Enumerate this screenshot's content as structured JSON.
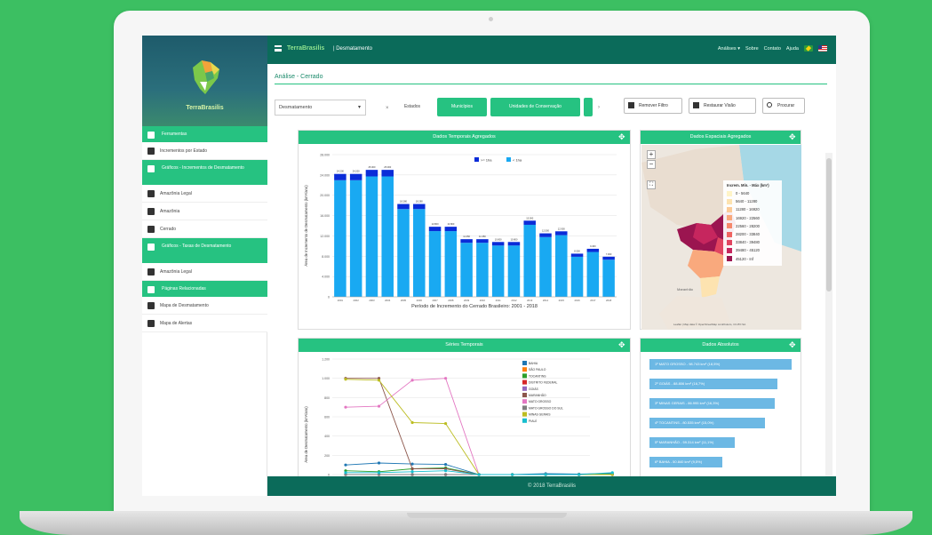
{
  "app": {
    "brand": "TerraBrasilis",
    "breadcrumb": "| Desmatamento",
    "logo_text": "TerraBrasilis",
    "footer": "© 2018 TerraBrasilis"
  },
  "nav": {
    "items": [
      "Análises ▾",
      "Sobre",
      "Contato",
      "Ajuda"
    ]
  },
  "sidebar": {
    "items": [
      {
        "type": "head",
        "label": "Ferramentas",
        "icon": "wrench-icon"
      },
      {
        "type": "item",
        "label": "Incrementos por Estado",
        "icon": "cloud-icon"
      },
      {
        "type": "head",
        "label": "Gráficos - Incrementos de Desmatamento",
        "icon": "chart-icon"
      },
      {
        "type": "item",
        "label": "Amazônia Legal",
        "icon": "chart-icon"
      },
      {
        "type": "item",
        "label": "Amazônia",
        "icon": "chart-icon"
      },
      {
        "type": "item",
        "label": "Cerrado",
        "icon": "chart-icon"
      },
      {
        "type": "head",
        "label": "Gráficos - Taxas de Desmatamento",
        "icon": "chart-icon"
      },
      {
        "type": "item",
        "label": "Amazônia Legal",
        "icon": "chart-icon"
      },
      {
        "type": "head",
        "label": "Páginas Relacionadas",
        "icon": "link-icon"
      },
      {
        "type": "item",
        "label": "Mapa de Desmatamento",
        "icon": "map-icon"
      },
      {
        "type": "item",
        "label": "Mapa de Alertas",
        "icon": "map-icon"
      }
    ]
  },
  "page": {
    "title": "Análise - Cerrado"
  },
  "toolbar": {
    "select_value": "Desmatamento",
    "tabs": [
      "Estados",
      "Municípios",
      "Unidades de Conservação"
    ],
    "remove_filter": "Remover Filtro",
    "restore_view": "Restaurar Visão",
    "search": "Procurar"
  },
  "panels": {
    "temporal": "Dados Temporais Agregados",
    "spatial": "Dados Espaciais Agregados",
    "series": "Séries Temporais",
    "absolute": "Dados Absolutos"
  },
  "chart_data": [
    {
      "type": "bar",
      "xlabel": "Período de Incremento do Cerrado Brasileiro: 2001 - 2018",
      "ylabel": "Área de Incremento de Desmatamento (km²/ano)",
      "categories": [
        "2001",
        "2002",
        "2003",
        "2004",
        "2005",
        "2006",
        "2007",
        "2008",
        "2009",
        "2010",
        "2011",
        "2012",
        "2013",
        "2014",
        "2015",
        "2016",
        "2017",
        "2018"
      ],
      "series": [
        {
          "name": ">= 1ha",
          "values": [
            1240,
            1240,
            1290,
            1290,
            1000,
            1000,
            860,
            860,
            710,
            710,
            700,
            700,
            820,
            740,
            760,
            610,
            630,
            590
          ]
        },
        {
          "name": "< 1ha",
          "values": [
            22960,
            22960,
            23710,
            23710,
            17280,
            17280,
            12940,
            12940,
            10640,
            10640,
            10100,
            10100,
            14180,
            11760,
            12140,
            7890,
            8830,
            7310
          ]
        }
      ],
      "ylim": [
        0,
        28000
      ],
      "colors": [
        "#0a2cd8",
        "#19a9f2"
      ]
    },
    {
      "type": "line",
      "ylabel": "Área de Desmatamento (km²/ano)",
      "series": [
        {
          "name": "BAHIA",
          "color": "#1f77b4",
          "values": [
            100,
            120,
            110,
            105,
            0,
            0,
            10,
            5,
            12
          ]
        },
        {
          "name": "SÃO PAULO",
          "color": "#ff7f0e",
          "values": [
            0,
            0,
            0,
            0,
            0,
            0,
            0,
            0,
            0
          ]
        },
        {
          "name": "TOCANTINS",
          "color": "#2ca02c",
          "values": [
            40,
            30,
            60,
            70,
            0,
            0,
            0,
            0,
            5
          ]
        },
        {
          "name": "DISTRITO FEDERAL",
          "color": "#d62728",
          "values": [
            0,
            0,
            0,
            0,
            0,
            0,
            0,
            0,
            0
          ]
        },
        {
          "name": "GOIÁS",
          "color": "#9467bd",
          "values": [
            0,
            0,
            0,
            0,
            0,
            0,
            0,
            0,
            0
          ]
        },
        {
          "name": "MARANHÃO",
          "color": "#8c564b",
          "values": [
            1000,
            1000,
            60,
            60,
            0,
            0,
            0,
            0,
            0
          ]
        },
        {
          "name": "MATO GROSSO",
          "color": "#e377c2",
          "values": [
            700,
            710,
            980,
            1000,
            0,
            0,
            0,
            0,
            0
          ]
        },
        {
          "name": "MATO GROSSO DO SUL",
          "color": "#7f7f7f",
          "values": [
            0,
            0,
            0,
            0,
            0,
            0,
            0,
            0,
            0
          ]
        },
        {
          "name": "MINAS GERAIS",
          "color": "#bcbd22",
          "values": [
            990,
            980,
            540,
            530,
            0,
            0,
            0,
            0,
            0
          ]
        },
        {
          "name": "PIAUÍ",
          "color": "#17becf",
          "values": [
            20,
            20,
            30,
            40,
            0,
            0,
            0,
            0,
            20
          ]
        }
      ],
      "ylim": [
        0,
        1200
      ]
    },
    {
      "type": "bar",
      "orientation": "horizontal",
      "categories": [
        "MATO GROSSO",
        "GOIÁS",
        "MINAS GERAIS",
        "TOCANTINS",
        "MARANHÃO",
        "BAHIA"
      ],
      "labels": [
        "1º MATO GROSSO - 98.743 km² (18,5%)",
        "2º GOIÁS - 88.806 km² (16,7%)",
        "3º MINAS GERAIS - 86.995 km² (16,3%)",
        "4º TOCANTINS - 80.535 km² (15,0%)",
        "5º MARANHÃO - 59.314 km² (11,1%)",
        "6º BAHIA - 50.840 km² (9,5%)"
      ],
      "values": [
        98743,
        88806,
        86995,
        80535,
        59314,
        50840
      ]
    }
  ],
  "map": {
    "legend_title": "Increm. Mín. - Máx (km²)",
    "legend": [
      {
        "label": "0 - 5640",
        "color": "#fff4c7"
      },
      {
        "label": "5640 - 11280",
        "color": "#fde3b0"
      },
      {
        "label": "11280 - 16920",
        "color": "#fccb97"
      },
      {
        "label": "16920 - 22560",
        "color": "#f9a97d"
      },
      {
        "label": "22560 - 28200",
        "color": "#f5886b"
      },
      {
        "label": "28200 - 33840",
        "color": "#ef6461"
      },
      {
        "label": "33840 - 39480",
        "color": "#e14460"
      },
      {
        "label": "39480 - 45120",
        "color": "#c6265e"
      },
      {
        "label": "45120 - Inf",
        "color": "#9b1550"
      }
    ],
    "attribution": "Leaflet | Map data © OpenStreetMap contributors, CC-BY-SA"
  },
  "colors": {
    "green": "#26c281",
    "dark": "#0b6b5a",
    "background": "#3cbf62"
  }
}
